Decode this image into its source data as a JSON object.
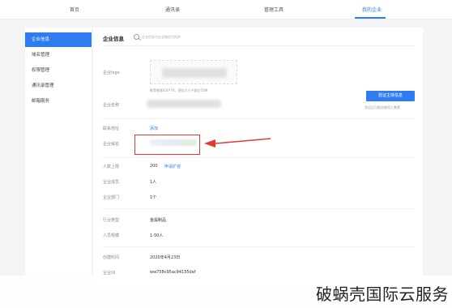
{
  "topnav": {
    "items": [
      "首页",
      "通讯录",
      "管理工具",
      "我的企业"
    ]
  },
  "sidebar": {
    "items": [
      "企业信息",
      "域名管理",
      "权限管理",
      "通讯录管理",
      "邮箱服务"
    ]
  },
  "main": {
    "title": "企业信息",
    "search_hint": "企业信息与企业微信可同步",
    "logo_label": "企业logo",
    "logo_hint": "推荐像素430*74，建议大小不超过50M",
    "name_label": "企业名称",
    "verify_button": "验证主体信息",
    "verify_hint": "验证后可报告使用人数等",
    "contact_label": "联系地址",
    "contact_link": "添加",
    "domain_label": "企业域名",
    "limit_label": "人数上限",
    "limit_value": "200",
    "limit_link": "申请扩容",
    "members_label": "企业成员",
    "members_value": "1人",
    "depts_label": "企业部门",
    "depts_value": "1个",
    "industry_label": "行业类型",
    "industry_value": "金属制品",
    "scale_label": "人员规模",
    "scale_value": "1-50人",
    "created_label": "创建时间",
    "created_value": "2020年4月23日",
    "corpid_label": "企业ID",
    "corpid_value": "ww758c95ac94155def"
  },
  "watermark": "破蜗壳国际云服务",
  "colors": {
    "accent": "#2f7bf0",
    "highlight": "#e23b32"
  }
}
